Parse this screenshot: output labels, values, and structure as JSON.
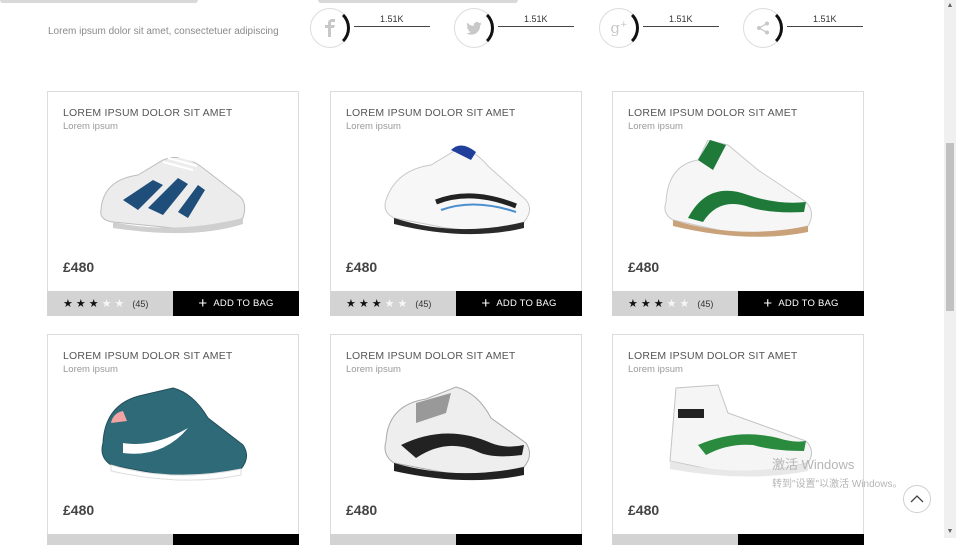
{
  "header": {
    "tagline": "Lorem ipsum dolor sit amet, consectetuer adipiscing"
  },
  "social": [
    {
      "name": "facebook-icon",
      "count": "1.51K"
    },
    {
      "name": "twitter-icon",
      "count": "1.51K"
    },
    {
      "name": "google-plus-icon",
      "count": "1.51K"
    },
    {
      "name": "share-icon",
      "count": "1.51K"
    }
  ],
  "products": [
    {
      "title": "LOREM IPSUM DOLOR SIT AMET",
      "subtitle": "Lorem ipsum",
      "price": "£480",
      "rating": 3,
      "reviews": "(45)",
      "cta": "ADD TO BAG",
      "colors": {
        "accent": "#1f4e7a",
        "body": "#e6e6e6"
      }
    },
    {
      "title": "LOREM IPSUM DOLOR SIT AMET",
      "subtitle": "Lorem ipsum",
      "price": "£480",
      "rating": 3,
      "reviews": "(45)",
      "cta": "ADD TO BAG",
      "colors": {
        "accent": "#1f3f9a",
        "body": "#f3f3f3"
      }
    },
    {
      "title": "LOREM IPSUM DOLOR SIT AMET",
      "subtitle": "Lorem ipsum",
      "price": "£480",
      "rating": 3,
      "reviews": "(45)",
      "cta": "ADD TO BAG",
      "colors": {
        "accent": "#1f7a3a",
        "body": "#f3f3f3"
      }
    },
    {
      "title": "LOREM IPSUM DOLOR SIT AMET",
      "subtitle": "Lorem ipsum",
      "price": "£480",
      "rating": null,
      "reviews": "",
      "cta": "",
      "colors": {
        "accent": "#2e6a78",
        "body": "#2e6a78"
      }
    },
    {
      "title": "LOREM IPSUM DOLOR SIT AMET",
      "subtitle": "Lorem ipsum",
      "price": "£480",
      "rating": null,
      "reviews": "",
      "cta": "",
      "colors": {
        "accent": "#222222",
        "body": "#eeeeee"
      }
    },
    {
      "title": "LOREM IPSUM DOLOR SIT AMET",
      "subtitle": "Lorem ipsum",
      "price": "£480",
      "rating": null,
      "reviews": "",
      "cta": "",
      "colors": {
        "accent": "#2a8a3e",
        "body": "#f4f4f4"
      }
    }
  ],
  "watermark": {
    "line1": "激活 Windows",
    "line2": "转到\"设置\"以激活 Windows。"
  }
}
